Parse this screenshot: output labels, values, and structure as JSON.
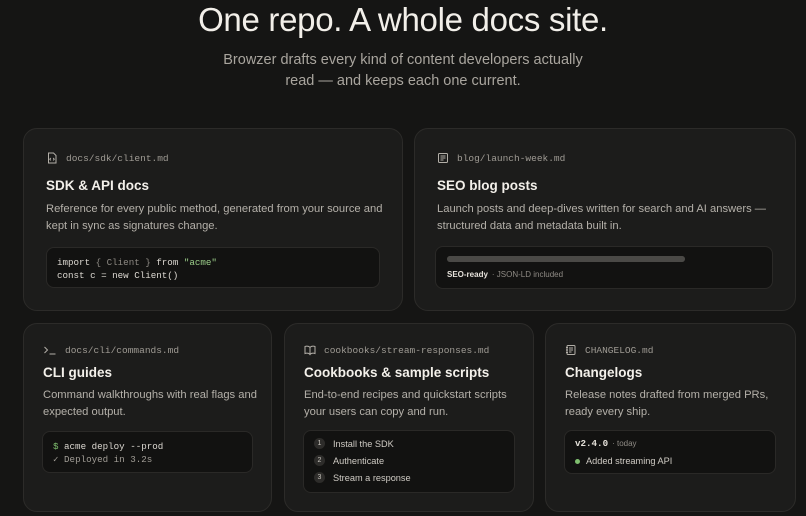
{
  "hero": {
    "title": "One repo. A whole docs site.",
    "subtitle_line1": "Browzer drafts every kind of content developers actually",
    "subtitle_line2": "read — and keeps each one current."
  },
  "cards": {
    "sdk": {
      "path": "docs/sdk/client.md",
      "icon": "file-code-icon",
      "title": "SDK & API docs",
      "desc_line1": "Reference for every public method, generated from your source and",
      "desc_line2": "kept in sync as signatures change.",
      "code": {
        "l1_kw": "import",
        "l1_brace_open": "{",
        "l1_name": "Client",
        "l1_brace_close": "}",
        "l1_from": "from",
        "l1_str": "\"acme\"",
        "l2": "const c = new Client()"
      }
    },
    "blog": {
      "path": "blog/launch-week.md",
      "icon": "newspaper-icon",
      "title": "SEO blog posts",
      "desc_line1": "Launch posts and deep-dives written for search and AI answers —",
      "desc_line2": "structured data and metadata built in.",
      "badge": "SEO-ready",
      "badge_note": "· JSON-LD included",
      "bar_fraction": 1.0
    },
    "cli": {
      "path": "docs/cli/commands.md",
      "icon": "terminal-icon",
      "title": "CLI guides",
      "desc_line1": "Command walkthroughs with real flags and",
      "desc_line2": "expected output.",
      "prompt": "$",
      "command": "acme deploy --prod",
      "output": "✓ Deployed in 3.2s"
    },
    "cookbooks": {
      "path": "cookbooks/stream-responses.md",
      "icon": "book-open-icon",
      "title": "Cookbooks & sample scripts",
      "desc_line1": "End-to-end recipes and quickstart scripts",
      "desc_line2": "your users can copy and run.",
      "steps": [
        {
          "num": "1",
          "label": "Install the SDK"
        },
        {
          "num": "2",
          "label": "Authenticate"
        },
        {
          "num": "3",
          "label": "Stream a response"
        }
      ]
    },
    "changelog": {
      "path": "CHANGELOG.md",
      "icon": "changelog-icon",
      "title": "Changelogs",
      "desc_line1": "Release notes drafted from merged PRs,",
      "desc_line2": "ready every ship.",
      "version": "v2.4.0",
      "version_note": "· today",
      "entry": "Added streaming API",
      "entry_dot_color": "#7fbf6f"
    }
  },
  "colors": {
    "background": "#151514",
    "card": "#1c1c1b",
    "accent_green": "#7fbf6f"
  }
}
